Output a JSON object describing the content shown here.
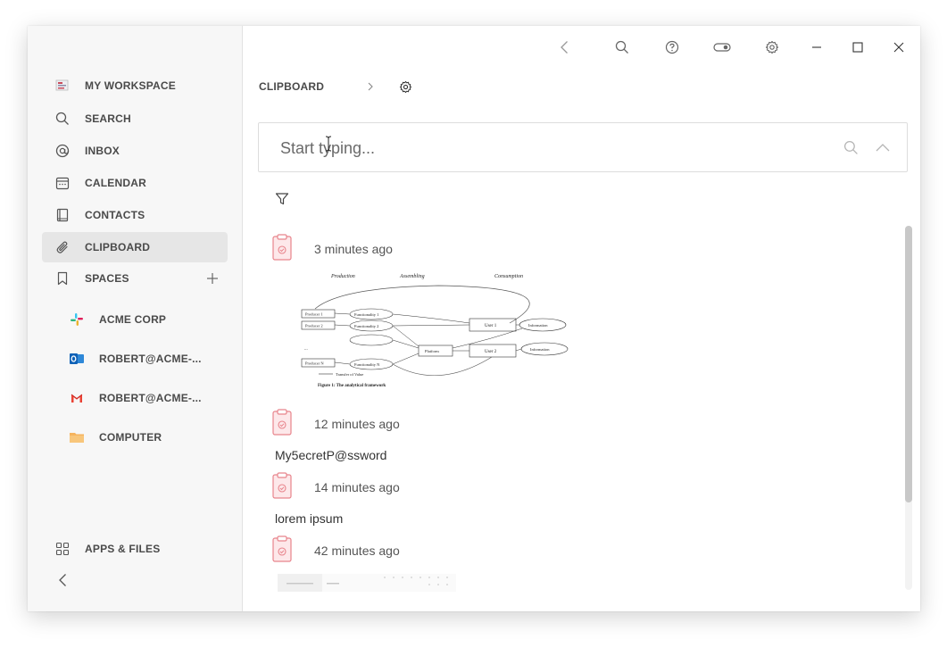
{
  "sidebar": {
    "items": [
      {
        "label": "MY WORKSPACE",
        "icon": "workspace-icon"
      },
      {
        "label": "SEARCH",
        "icon": "search-icon"
      },
      {
        "label": "INBOX",
        "icon": "at-icon"
      },
      {
        "label": "CALENDAR",
        "icon": "calendar-icon"
      },
      {
        "label": "CONTACTS",
        "icon": "contacts-book-icon"
      },
      {
        "label": "CLIPBOARD",
        "icon": "paperclip-icon",
        "active": true
      },
      {
        "label": "SPACES",
        "icon": "bookmark-icon"
      }
    ],
    "spaces": [
      {
        "label": "ACME CORP",
        "icon": "slack-icon"
      },
      {
        "label": "ROBERT@ACME-...",
        "icon": "outlook-icon"
      },
      {
        "label": "ROBERT@ACME-...",
        "icon": "gmail-icon"
      },
      {
        "label": "COMPUTER",
        "icon": "folder-icon"
      }
    ],
    "apps_label": "APPS & FILES"
  },
  "breadcrumb": {
    "title": "CLIPBOARD"
  },
  "search": {
    "placeholder": "Start typing..."
  },
  "clipboard": {
    "items": [
      {
        "time": "3 minutes ago",
        "type": "image"
      },
      {
        "time": "12 minutes ago",
        "type": "text",
        "text": "My5ecretP@ssword"
      },
      {
        "time": "14 minutes ago",
        "type": "text",
        "text": "lorem ipsum"
      },
      {
        "time": "42 minutes ago",
        "type": "image"
      }
    ],
    "diagram": {
      "header_production": "Production",
      "header_assembling": "Assembling",
      "header_consumption": "Consumption",
      "producer1": "Producer 1",
      "producer2": "Producer 2",
      "producerN": "Producer N",
      "func1": "Functionality 1",
      "func2": "Functionality 2",
      "funcN": "Functionality N",
      "platform": "Platform",
      "user1": "User 1",
      "user2": "User 2",
      "info1": "Information",
      "info2": "Information",
      "ellipsis": "...",
      "legend": "Transfer of Value",
      "caption": "Figure 1: The analytical framework"
    }
  },
  "colors": {
    "accent_clip": "#e8848c",
    "active_bg": "#e6e6e6",
    "sidebar_bg": "#f7f7f7"
  }
}
